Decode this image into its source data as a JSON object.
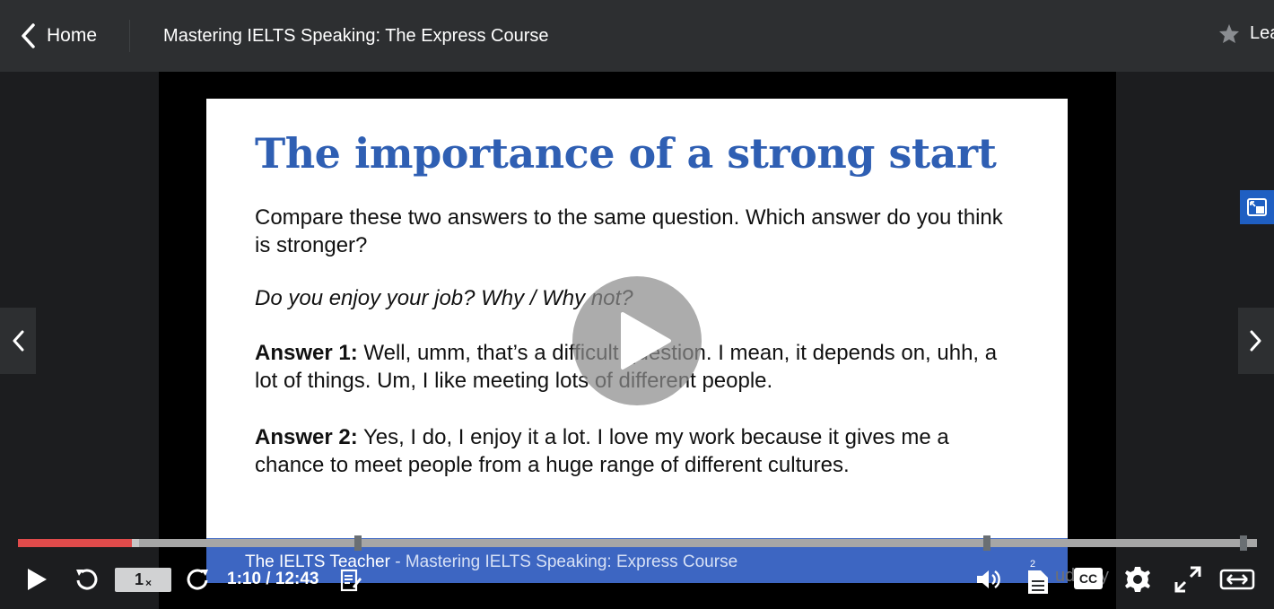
{
  "header": {
    "home_label": "Home",
    "course_title": "Mastering IELTS Speaking: The Express Course",
    "leave_label": "Leave a rating"
  },
  "slide": {
    "title": "The importance of a strong start",
    "intro": "Compare these two answers to the same question. Which answer do you think is stronger?",
    "question": "Do you enjoy your job? Why / Why not?",
    "answer1_label": "Answer 1:",
    "answer1_text": " Well, umm, that’s a difficult question. I mean, it depends on, uhh, a lot of things. Um, I like meeting lots of different people.",
    "answer2_label": "Answer 2:",
    "answer2_text": " Yes, I do, I enjoy it a lot. I love my work because it gives me a chance to meet people from a huge range of different cultures.",
    "footer_brand": "The IELTS Teacher",
    "footer_sep": " - ",
    "footer_course": "Mastering IELTS Speaking: Express Course",
    "watermark": "udemy"
  },
  "player": {
    "speed": "1",
    "speed_suffix": "×",
    "time_display": "1:10 / 12:43",
    "captions_label": "CC",
    "transcript_badge": "2",
    "progress_fraction": 0.092,
    "buffered_fraction": 0.098
  },
  "colors": {
    "accent_red": "#e04b4b",
    "slide_title_blue": "#2f5fb3",
    "footer_blue": "#3d66c2",
    "pip_blue": "#1f5fc2"
  }
}
